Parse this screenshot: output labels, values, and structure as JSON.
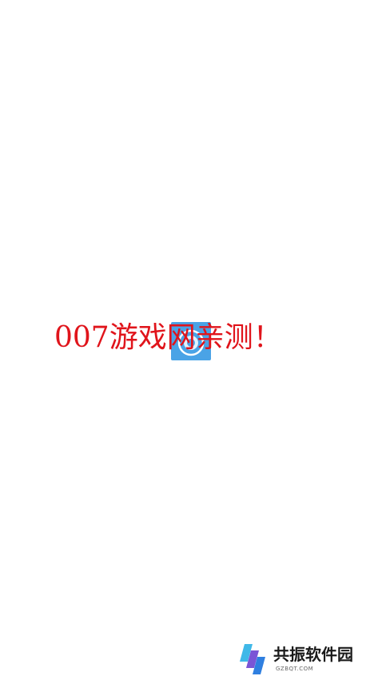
{
  "splash": {
    "message": "007游戏网亲测！",
    "message_color": "#e0141b",
    "app_icon": "circular-app-icon",
    "app_icon_color": "#4aa3e6"
  },
  "watermark": {
    "logo": "gongzhen-logo-icon",
    "name": "共振软件园",
    "url": "GZBQT.COM"
  }
}
